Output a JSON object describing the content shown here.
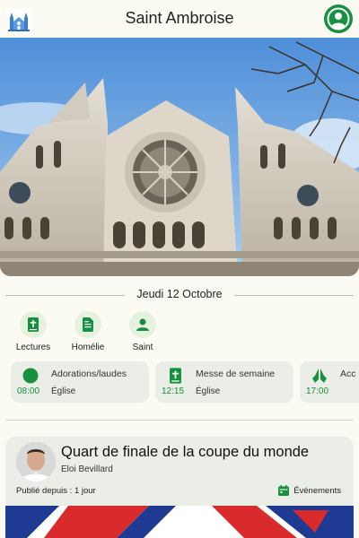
{
  "header": {
    "title": "Saint Ambroise",
    "logo_icon": "church-logo-icon",
    "account_icon": "user-account-icon"
  },
  "hero": {
    "image": "church-facade-photo"
  },
  "date": {
    "label": "Jeudi 12 Octobre"
  },
  "quick_links": [
    {
      "label": "Lectures",
      "icon": "bible-icon"
    },
    {
      "label": "Homélie",
      "icon": "document-icon"
    },
    {
      "label": "Saint",
      "icon": "person-icon"
    }
  ],
  "schedule": [
    {
      "name": "Adorations/laudes",
      "time": "08:00",
      "place": "Église",
      "icon": "circle-icon"
    },
    {
      "name": "Messe de semaine",
      "time": "12:15",
      "place": "Église",
      "icon": "bible-icon"
    },
    {
      "name": "Acc",
      "time": "17:00",
      "place": "",
      "icon": "praying-hands-icon"
    }
  ],
  "news": {
    "headline": "Quart de finale de la coupe du monde",
    "author": "Eloi Bevillard",
    "published": "Publié depuis : 1 jour",
    "category": "Événements",
    "category_icon": "calendar-icon"
  },
  "colors": {
    "accent": "#16913f",
    "background": "#fbfbf4",
    "card": "#eaeee6"
  }
}
